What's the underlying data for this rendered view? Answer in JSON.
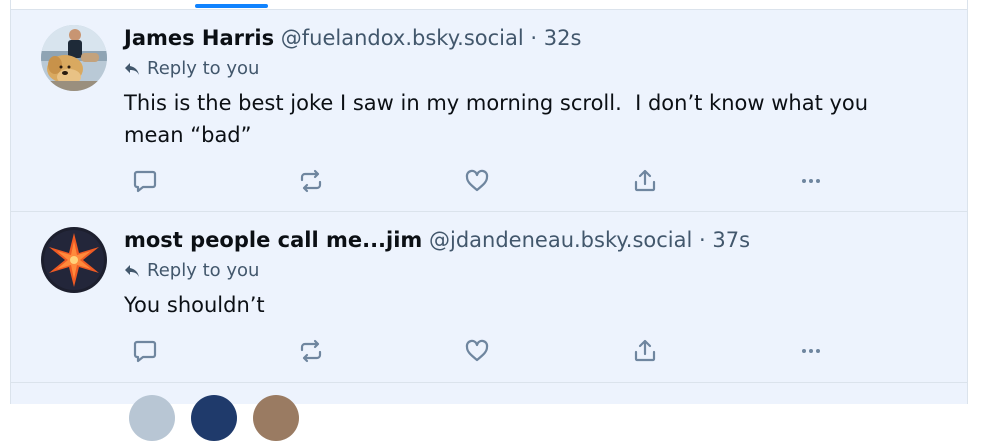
{
  "posts": [
    {
      "author_name": "James Harris",
      "author_handle": "@fuelandox.bsky.social",
      "separator": "·",
      "timestamp": "32s",
      "reply_label": "Reply to you",
      "text": "This is the best joke I saw in my morning scroll.  I don’t know what you\nmean “bad”",
      "avatar_icon": "man-with-dog-photo-avatar"
    },
    {
      "author_name": "most people call me...jim",
      "author_handle": "@jdandeneau.bsky.social",
      "separator": "·",
      "timestamp": "37s",
      "reply_label": "Reply to you",
      "text": "You shouldn’t",
      "avatar_icon": "star-burst-avatar"
    }
  ],
  "action_icons": [
    "reply-icon",
    "repost-icon",
    "like-icon",
    "share-icon",
    "more-options-icon"
  ],
  "colors": {
    "accent": "#1083fe",
    "background": "#edf3fd",
    "muted_text": "#42576c",
    "text": "#0b0f14",
    "border": "#dbe3ec"
  }
}
